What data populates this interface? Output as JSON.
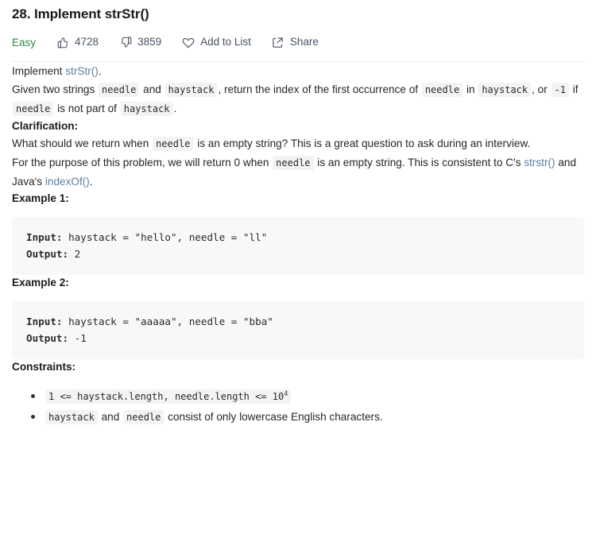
{
  "header": {
    "title": "28. Implement strStr()",
    "difficulty": "Easy",
    "difficulty_color": "#2e8b45",
    "actions": [
      {
        "icon": "thumbs-up-icon",
        "label": "4728"
      },
      {
        "icon": "thumbs-down-icon",
        "label": "3859"
      },
      {
        "icon": "heart-icon",
        "label": "Add to List"
      },
      {
        "icon": "share-icon",
        "label": "Share"
      }
    ]
  },
  "content": {
    "implement": {
      "prefix": "Implement ",
      "link": "strStr()",
      "suffix": "."
    },
    "given": {
      "t1": "Given two strings ",
      "c1": "needle",
      "t2": " and ",
      "c2": "haystack",
      "t3": ", return the index of the first occurrence of ",
      "c3": "needle",
      "t4": " in ",
      "c4": "haystack",
      "t5": ", or ",
      "c5": "-1",
      "t6": " if ",
      "c6": "needle",
      "t7": " is not part of ",
      "c7": "haystack",
      "t8": "."
    },
    "clarification_heading": "Clarification:",
    "what_should": {
      "t1": "What should we return when ",
      "c1": "needle",
      "t2": " is an empty string? This is a great question to ask during an interview."
    },
    "for_purpose": {
      "t1": "For the purpose of this problem, we will return 0 when ",
      "c1": "needle",
      "t2": " is an empty string. This is consistent to C's ",
      "link1": "strstr()",
      "t3": " and Java's ",
      "link2": "indexOf()",
      "t4": "."
    },
    "examples": [
      {
        "heading": "Example 1:",
        "input_label": "Input:",
        "input_value": " haystack = \"hello\", needle = \"ll\"",
        "output_label": "Output:",
        "output_value": " 2"
      },
      {
        "heading": "Example 2:",
        "input_label": "Input:",
        "input_value": " haystack = \"aaaaa\", needle = \"bba\"",
        "output_label": "Output:",
        "output_value": " -1"
      }
    ],
    "constraints_heading": "Constraints:",
    "constraints": [
      {
        "code_main": "1 <= haystack.length, needle.length <= 10",
        "code_sup": "4",
        "text_after": ""
      },
      {
        "c1": "haystack",
        "t1": " and ",
        "c2": "needle",
        "t2": " consist of only lowercase English characters."
      }
    ]
  }
}
